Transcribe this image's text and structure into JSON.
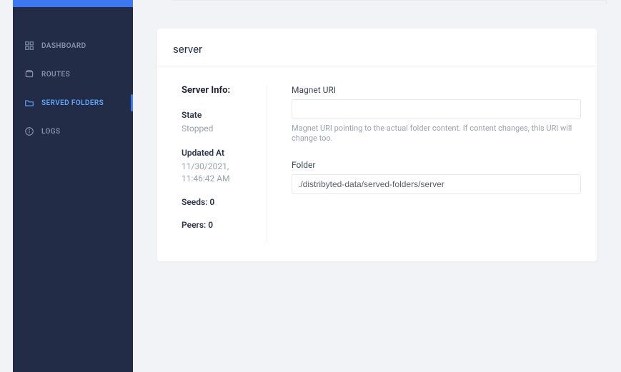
{
  "sidebar": {
    "items": [
      {
        "label": "DASHBOARD"
      },
      {
        "label": "ROUTES"
      },
      {
        "label": "SERVED FOLDERS"
      },
      {
        "label": "LOGS"
      }
    ]
  },
  "page": {
    "title": "server"
  },
  "server_info": {
    "heading": "Server Info:",
    "state_label": "State",
    "state_value": "Stopped",
    "updated_label": "Updated At",
    "updated_value": "11/30/2021, 11:46:42 AM",
    "seeds_label": "Seeds:",
    "seeds_value": "0",
    "peers_label": "Peers:",
    "peers_value": "0"
  },
  "form": {
    "magnet": {
      "label": "Magnet URI",
      "value": "",
      "help": "Magnet URI pointing to the actual folder content. If content changes, this URI will change too."
    },
    "folder": {
      "label": "Folder",
      "value": "./distribyted-data/served-folders/server"
    }
  }
}
